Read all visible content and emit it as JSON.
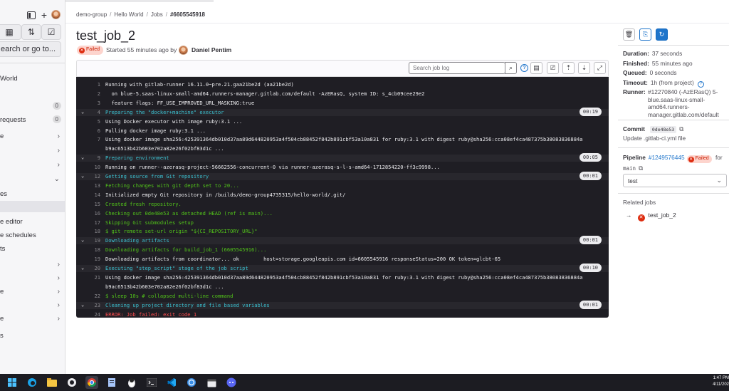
{
  "sidebar": {
    "search_label": "earch or go to...",
    "items": [
      {
        "label": "World",
        "badge": "",
        "chevron": false
      },
      {
        "label": "",
        "badge": "0",
        "chevron": false
      },
      {
        "label": "requests",
        "badge": "0",
        "chevron": false
      },
      {
        "label": "e",
        "badge": "",
        "chevron": true
      },
      {
        "label": "",
        "badge": "",
        "chevron": true
      },
      {
        "label": "",
        "badge": "",
        "chevron": true
      },
      {
        "label": "",
        "badge": "",
        "chevron": true
      },
      {
        "label": "es",
        "badge": "",
        "chevron": false
      },
      {
        "label": "",
        "badge": "",
        "chevron": false
      },
      {
        "label": "e editor",
        "badge": "",
        "chevron": false
      },
      {
        "label": "e schedules",
        "badge": "",
        "chevron": false
      },
      {
        "label": "ts",
        "badge": "",
        "chevron": false
      },
      {
        "label": "",
        "badge": "",
        "chevron": true
      },
      {
        "label": "",
        "badge": "",
        "chevron": true
      },
      {
        "label": "e",
        "badge": "",
        "chevron": true
      },
      {
        "label": "",
        "badge": "",
        "chevron": true
      },
      {
        "label": "e",
        "badge": "",
        "chevron": true
      },
      {
        "label": "r",
        "badge": "",
        "chevron": true
      },
      {
        "label": "",
        "badge": "",
        "chevron": true
      },
      {
        "label": "s",
        "badge": "",
        "chevron": false
      }
    ]
  },
  "breadcrumb": {
    "items": [
      "demo-group",
      "Hello World",
      "Jobs",
      "#6605545918"
    ]
  },
  "job": {
    "title": "test_job_2",
    "status": "Failed",
    "started_text": "Started 55 minutes ago by",
    "author": "Daniel Pentim"
  },
  "log_toolbar": {
    "search_placeholder": "Search job log"
  },
  "log": [
    {
      "n": "1",
      "text": "Running with gitlab-runner 16.11.0~pre.21.gaa21be2d (aa21be2d)",
      "color": "white",
      "section": false,
      "caret": false,
      "dur": ""
    },
    {
      "n": "2",
      "text": "  on blue-5.saas-linux-small-amd64.runners-manager.gitlab.com/default -AzERasQ, system ID: s_4cb09cee29e2",
      "color": "white",
      "section": false,
      "caret": false,
      "dur": ""
    },
    {
      "n": "3",
      "text": "  feature flags: FF_USE_IMPROVED_URL_MASKING:true",
      "color": "white",
      "section": false,
      "caret": false,
      "dur": ""
    },
    {
      "n": "4",
      "text": "Preparing the \"docker+machine\" executor",
      "color": "cyan",
      "section": true,
      "caret": true,
      "dur": "00:19"
    },
    {
      "n": "5",
      "text": "Using Docker executor with image ruby:3.1 ...",
      "color": "white",
      "section": false,
      "caret": false,
      "dur": ""
    },
    {
      "n": "6",
      "text": "Pulling docker image ruby:3.1 ...",
      "color": "white",
      "section": false,
      "caret": false,
      "dur": ""
    },
    {
      "n": "7",
      "text": "Using docker image sha256:425391364db010d37aa89d644820953a4f504cb88452f842b891cbf53a10a831 for ruby:3.1 with digest ruby@sha256:cca08ef4ca487375b38083836884a",
      "color": "white",
      "section": false,
      "caret": false,
      "dur": ""
    },
    {
      "n": "",
      "text": "b9ac6513b42b603e702a82e26f02bf83d1c ...",
      "color": "white",
      "section": false,
      "caret": false,
      "dur": ""
    },
    {
      "n": "9",
      "text": "Preparing environment",
      "color": "cyan",
      "section": true,
      "caret": true,
      "dur": "00:05"
    },
    {
      "n": "10",
      "text": "Running on runner--azerasq-project-56662556-concurrent-0 via runner-azerasq-s-l-s-amd64-1712854220-ff3c9998...",
      "color": "white",
      "section": false,
      "caret": false,
      "dur": ""
    },
    {
      "n": "12",
      "text": "Getting source from Git repository",
      "color": "cyan",
      "section": true,
      "caret": true,
      "dur": "00:01"
    },
    {
      "n": "13",
      "text": "Fetching changes with git depth set to 20...",
      "color": "green",
      "section": false,
      "caret": false,
      "dur": ""
    },
    {
      "n": "14",
      "text": "Initialized empty Git repository in /builds/demo-group4735315/hello-world/.git/",
      "color": "white",
      "section": false,
      "caret": false,
      "dur": ""
    },
    {
      "n": "15",
      "text": "Created fresh repository.",
      "color": "green",
      "section": false,
      "caret": false,
      "dur": ""
    },
    {
      "n": "16",
      "text": "Checking out 0de48e53 as detached HEAD (ref is main)...",
      "color": "green",
      "section": false,
      "caret": false,
      "dur": ""
    },
    {
      "n": "17",
      "text": "Skipping Git submodules setup",
      "color": "green",
      "section": false,
      "caret": false,
      "dur": ""
    },
    {
      "n": "18",
      "text": "$ git remote set-url origin \"${CI_REPOSITORY_URL}\"",
      "color": "green",
      "section": false,
      "caret": false,
      "dur": ""
    },
    {
      "n": "19",
      "text": "Downloading artifacts",
      "color": "cyan",
      "section": true,
      "caret": true,
      "dur": "00:01"
    },
    {
      "n": "18",
      "text": "Downloading artifacts for build_job_1 (6605545916)...",
      "color": "green",
      "section": false,
      "caret": false,
      "dur": ""
    },
    {
      "n": "19",
      "text": "Downloading artifacts from coordinator... ok        host=storage.googleapis.com id=6605545916 responseStatus=200 OK token=glcbt-65",
      "color": "white",
      "section": false,
      "caret": false,
      "dur": ""
    },
    {
      "n": "20",
      "text": "Executing \"step_script\" stage of the job script",
      "color": "cyan",
      "section": true,
      "caret": true,
      "dur": "00:10"
    },
    {
      "n": "21",
      "text": "Using docker image sha256:425391364db010d37aa89d644820953a4f504cb88452f842b891cbf53a10a831 for ruby:3.1 with digest ruby@sha256:cca08ef4ca487375b38083836884a",
      "color": "white",
      "section": false,
      "caret": false,
      "dur": ""
    },
    {
      "n": "",
      "text": "b9ac6513b42b603e702a82e26f02bf83d1c ...",
      "color": "white",
      "section": false,
      "caret": false,
      "dur": ""
    },
    {
      "n": "22",
      "text": "$ sleep 10s # collapsed multi-line command",
      "color": "green",
      "section": false,
      "caret": false,
      "dur": ""
    },
    {
      "n": "23",
      "text": "Cleaning up project directory and file based variables",
      "color": "cyan",
      "section": true,
      "caret": true,
      "dur": "00:01"
    },
    {
      "n": "24",
      "text": "ERROR: Job failed: exit code 1",
      "color": "red",
      "section": false,
      "caret": false,
      "dur": ""
    }
  ],
  "details": {
    "duration_label": "Duration:",
    "duration": "37 seconds",
    "finished_label": "Finished:",
    "finished": "55 minutes ago",
    "queued_label": "Queued:",
    "queued": "0 seconds",
    "timeout_label": "Timeout:",
    "timeout": "1h (from project)",
    "runner_label": "Runner:",
    "runner": "#12270840 (-AzERasQ) 5-blue.saas-linux-small-amd64.runners-manager.gitlab.com/default",
    "commit_label": "Commit",
    "commit_sha": "0de48e53",
    "commit_message": "Update .gitlab-ci.yml file",
    "pipeline_label": "Pipeline",
    "pipeline_id": "#1249576445",
    "pipeline_status": "Failed",
    "pipeline_for": "for",
    "branch": "main",
    "stage": "test",
    "related_jobs_label": "Related jobs",
    "related_job": "test_job_2"
  },
  "taskbar": {
    "time": "1:47 PM",
    "date": "4/11/202"
  }
}
